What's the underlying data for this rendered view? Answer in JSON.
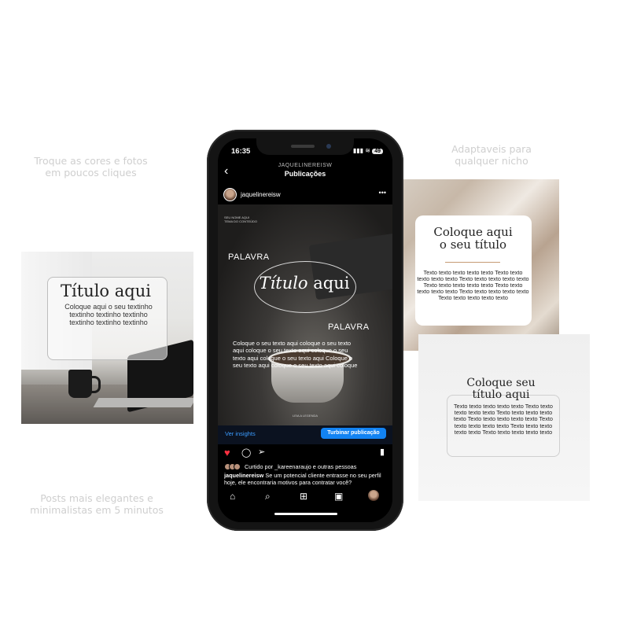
{
  "captions": {
    "top_left": "Troque as cores e fotos\nem poucos cliques",
    "top_right": "Adaptaveis para\nqualquer nicho",
    "bottom_left": "Posts mais elegantes e\nminimalistas em 5 minutos"
  },
  "left_card": {
    "title": "Título aqui",
    "body": "Coloque aqui o seu textinho textinho textinho textinho textinho textinho textinho"
  },
  "phone": {
    "status": {
      "time": "16:35",
      "signal": "▮▮▮",
      "wifi": "≋",
      "battery": "49"
    },
    "nav": {
      "username": "JAQUELINEREISW",
      "title": "Publicações"
    },
    "post": {
      "username": "jaquelinereisw",
      "small_top": "SEU NOME AQUI\nTEMA DO CONTEÚDO",
      "word1": "PALAVRA",
      "title_italic": "Título",
      "title_rest": " aqui",
      "word2": "PALAVRA",
      "body": "Coloque o seu texto aqui coloque o seu texto aqui coloque o seu texto aqui coloque o seu texto aqui coloque o seu texto aqui Coloque o seu texto aqui coloque o seu texto aqui coloque",
      "small_bottom": "LEIA A LEGENDA"
    },
    "insights_label": "Ver insights",
    "boost_label": "Turbinar publicação",
    "liked_by": "Curtido por _kareenaraujo e outras pessoas",
    "caption_user": "jaquelinereisw",
    "caption_text": " Se um potencial cliente entrasse no seu perfil hoje, ele encontraria motivos para contratar você?",
    "icons": {
      "home": "⌂",
      "search": "⌕",
      "create": "⊞",
      "reels": "▣"
    }
  },
  "top_right_card": {
    "title": "Coloque aqui\no seu título",
    "body": "Texto texto texto texto texto Texto texto texto texto texto Texto texto texto texto texto Texto texto texto texto texto Texto texto texto texto texto Texto texto texto texto texto Texto texto texto texto texto"
  },
  "bottom_right_card": {
    "title": "Coloque seu\ntítulo aqui",
    "body": "Texto texto texto texto texto Texto texto texto texto texto Texto texto texto texto texto Texto texto texto texto texto Texto texto texto texto texto Texto texto texto texto texto Texto texto texto texto texto"
  },
  "colors": {
    "like": "#ff3040",
    "boost": "#1283f3",
    "link": "#3b9cff",
    "accent_line": "#c59a74"
  }
}
